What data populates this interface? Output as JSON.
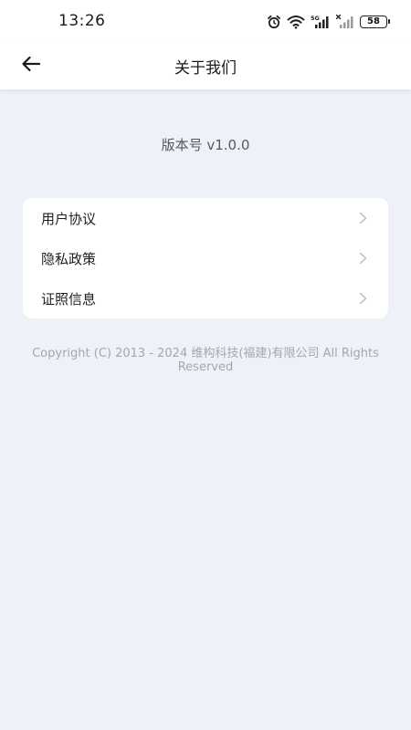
{
  "status_bar": {
    "time": "13:26",
    "battery": "58",
    "icons": [
      "alarm-icon",
      "wifi-icon",
      "signal-5g-icon",
      "signal-no-sim-icon",
      "battery-icon"
    ]
  },
  "nav": {
    "back_icon": "arrow-left-icon",
    "title": "关于我们"
  },
  "version_text": "版本号 v1.0.0",
  "menu": {
    "items": [
      {
        "label": "用户协议",
        "chevron": ">"
      },
      {
        "label": "隐私政策",
        "chevron": ">"
      },
      {
        "label": "证照信息",
        "chevron": ">"
      }
    ]
  },
  "copyright": "Copyright (C) 2013 - 2024 维构科技(福建)有限公司 All Rights Reserved",
  "colors": {
    "background": "#eef1f7",
    "card": "#ffffff",
    "text_primary": "#1f1f1f",
    "text_secondary": "#55595f",
    "text_muted": "#a2a8b3"
  }
}
